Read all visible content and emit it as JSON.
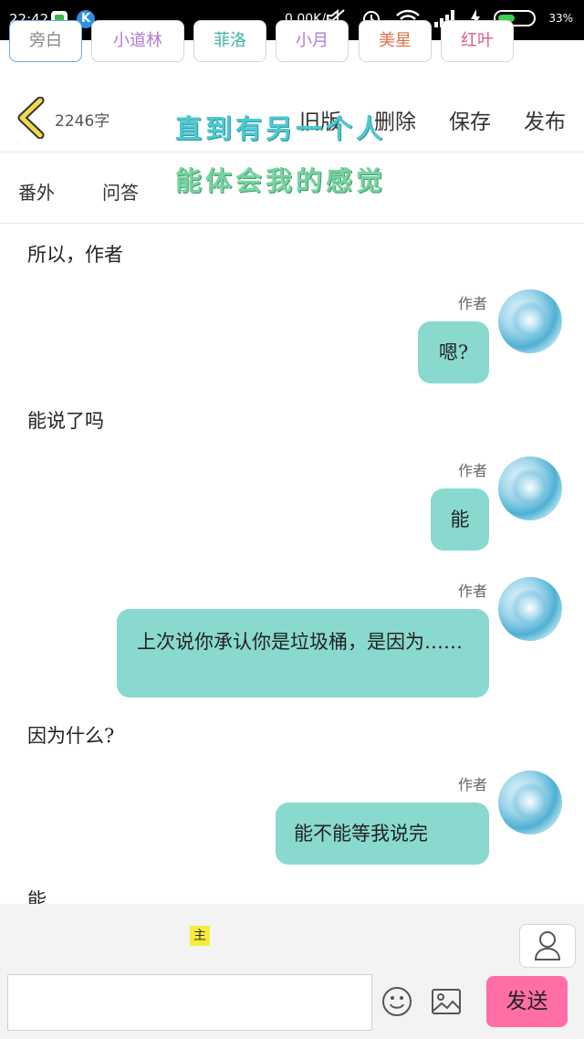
{
  "status_bar": {
    "time": "22:42",
    "app_icon_2": "K",
    "net_speed": "0.00K/s",
    "battery_percent": "33%"
  },
  "header": {
    "word_count": "2246字",
    "actions": [
      "旧版",
      "删除",
      "保存",
      "发布"
    ],
    "overlay_line1": "直到有另一个人",
    "overlay_line2": "能体会我的感觉"
  },
  "tabs": [
    "番外",
    "问答"
  ],
  "messages": [
    {
      "type": "narration",
      "text": "所以，作者"
    },
    {
      "type": "author",
      "name": "作者",
      "text": "嗯?"
    },
    {
      "type": "narration",
      "text": "能说了吗"
    },
    {
      "type": "author",
      "name": "作者",
      "text": "能"
    },
    {
      "type": "author",
      "name": "作者",
      "text": "上次说你承认你是垃圾桶，是因为……"
    },
    {
      "type": "narration",
      "text": "因为什么?"
    },
    {
      "type": "author",
      "name": "作者",
      "text": "能不能等我说完"
    },
    {
      "type": "narration",
      "text": "能"
    }
  ],
  "roles": [
    {
      "label": "旁白",
      "color": "#888888"
    },
    {
      "label": "小道林",
      "color": "#b07ad6"
    },
    {
      "label": "菲洛",
      "color": "#3fb3a6"
    },
    {
      "label": "小月",
      "color": "#b07ad6"
    },
    {
      "label": "美星",
      "color": "#e0704a"
    },
    {
      "label": "红叶",
      "color": "#e05a8e"
    }
  ],
  "main_badge": "主",
  "send_label": "发送",
  "input_value": ""
}
